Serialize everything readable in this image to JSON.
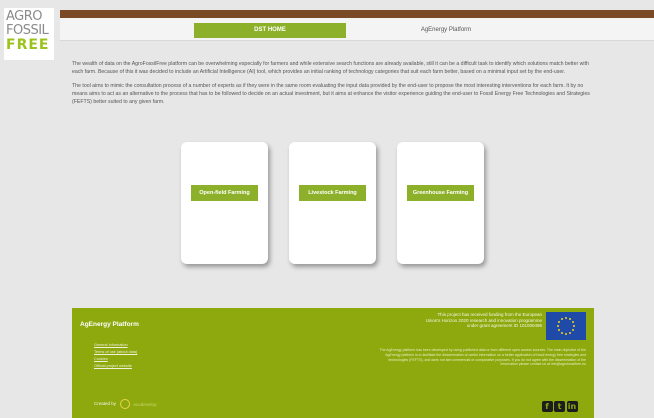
{
  "logo": {
    "line1": "AGRO",
    "line2": "FOSSIL",
    "line3": "FREE"
  },
  "tabs": [
    {
      "label": "DST HOME",
      "active": true
    },
    {
      "label": "AgEnergy Platform",
      "active": false
    }
  ],
  "intro": {
    "p1": "The wealth of data on the AgroFossilFree platform can be overwhelming especially for farmers and while extensive search functions are already available, still it can be a difficult task to identify which solutions match better with each farm. Because of this it was decided to include an Artificial Intelligence (AI) tool, which provides an initial ranking of technology categories that suit each farm better, based on a minimal input set by the end-user.",
    "p2": "The tool aims to mimic the consultation process of a number of experts as if they were in the same room evaluating the input data provided by the end-user to propose the most interesting interventions for each farm. It by no means aims to act as an alternative to the process that has to be followed to decide on an actual investment, but it aims at enhance the visitor experience guiding the end-user to Fossil Energy Free Technologies and Strategies (FEFTS) better suited to any given farm."
  },
  "cards": [
    {
      "label": "Open-field Farming"
    },
    {
      "label": "Livestock Farming"
    },
    {
      "label": "Greenhouse Farming"
    }
  ],
  "footer": {
    "title": "AgEnergy Platform",
    "links": [
      "General Information",
      "Terms of use (about data)",
      "Cookies",
      "Official project website"
    ],
    "funding": "This project has received funding from the European Union's Horizon 2020 research and innovation programme under grant agreement ID 101000496",
    "disclaimer": "The AgEnergy platform has been developed by using published data or from different open access sources. The main objective of the AgEnergy platform is to facilitate the dissemination of useful information on a better application of fossil energy free strategies and technologies (FEFTS), and does not aim commercial or comparative purposes. If you do not agree with the dissemination of the information please contact us at info@agrofossilfree.eu",
    "credit_label": "Created by",
    "credit_brand": "ecodevelop",
    "social": [
      {
        "icon": "facebook-icon",
        "glyph": "f"
      },
      {
        "icon": "twitter-icon",
        "glyph": "t"
      },
      {
        "icon": "linkedin-icon",
        "glyph": "in"
      }
    ]
  },
  "colors": {
    "accent_green": "#8db02a",
    "footer_green": "#8da90d",
    "top_brown": "#7a4a26",
    "eu_blue": "#1f4aa8"
  }
}
